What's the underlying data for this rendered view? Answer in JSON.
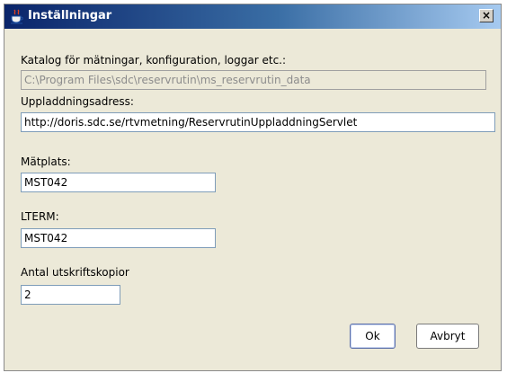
{
  "window": {
    "title": "Inställningar",
    "close_label": "×"
  },
  "fields": {
    "catalog_label": "Katalog för mätningar, konfiguration, loggar etc.:",
    "catalog_value": "C:\\Program Files\\sdc\\reservrutin\\ms_reservrutin_data",
    "upload_label": "Uppladdningsadress:",
    "upload_value": "http://doris.sdc.se/rtvmetning/ReservrutinUppladdningServlet",
    "matplats_label": "Mätplats:",
    "matplats_value": "MST042",
    "lterm_label": "LTERM:",
    "lterm_value": "MST042",
    "copies_label": "Antal utskriftskopior",
    "copies_value": "2"
  },
  "buttons": {
    "ok_label": "Ok",
    "cancel_label": "Avbryt"
  },
  "icons": {
    "app": "java-cup-icon"
  }
}
